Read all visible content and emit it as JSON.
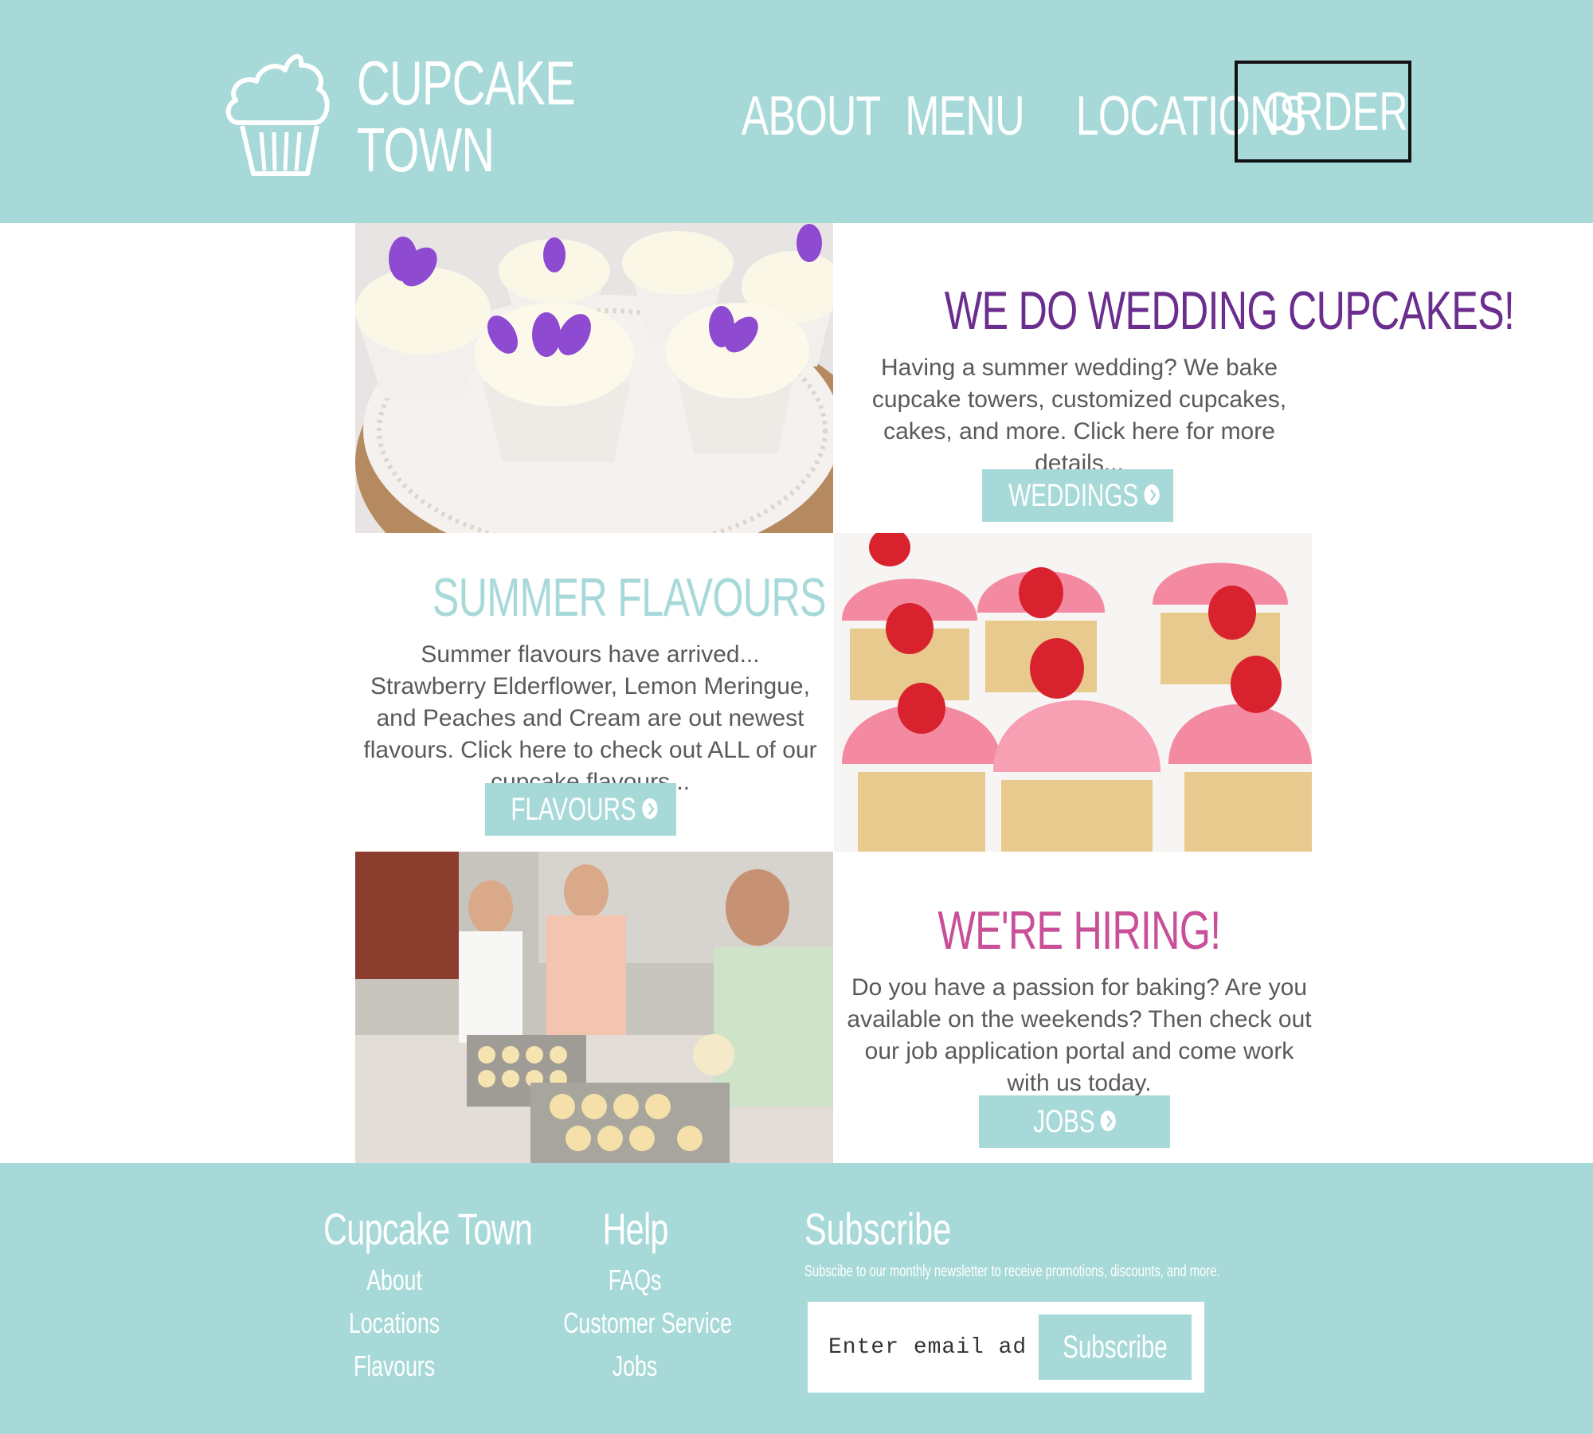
{
  "brand": {
    "line1": "CUPCAKE",
    "line2": "TOWN",
    "icon": "cupcake-icon"
  },
  "nav": {
    "items": [
      "ABOUT",
      "MENU",
      "LOCATIONS"
    ],
    "order": "ORDER"
  },
  "colors": {
    "teal": "#a7d9d8",
    "purple": "#6b2d8e",
    "pink": "#c84f98",
    "body_text": "#5a5a5a"
  },
  "blocks": {
    "weddings": {
      "title": "WE DO WEDDING CUPCAKES!",
      "body": "Having a summer wedding? We bake cupcake towers, customized cupcakes, cakes, and more. Click here for more details...",
      "button": "WEDDINGS",
      "image": "wedding-cupcakes-photo"
    },
    "flavours": {
      "title": "SUMMER FLAVOURS",
      "body": "Summer flavours have arrived... Strawberry Elderflower, Lemon Meringue, and Peaches and Cream are out newest flavours. Click here to check out ALL of our cupcake flavours...",
      "button": "FLAVOURS",
      "image": "strawberry-cupcakes-photo"
    },
    "hiring": {
      "title": "WE'RE HIRING!",
      "body": "Do you have a passion for baking? Are you available on the weekends? Then check out our job application portal and come work with us today.",
      "button": "JOBS",
      "image": "bakers-kitchen-photo"
    }
  },
  "footer": {
    "col1": {
      "title": "Cupcake Town",
      "links": [
        "About",
        "Locations",
        "Flavours"
      ]
    },
    "col2": {
      "title": "Help",
      "links": [
        "FAQs",
        "Customer Service",
        "Jobs"
      ]
    },
    "subscribe": {
      "title": "Subscribe",
      "desc": "Subscibe to our monthly newsletter to receive promotions, discounts, and more.",
      "placeholder": "Enter email address",
      "button": "Subscribe"
    }
  }
}
